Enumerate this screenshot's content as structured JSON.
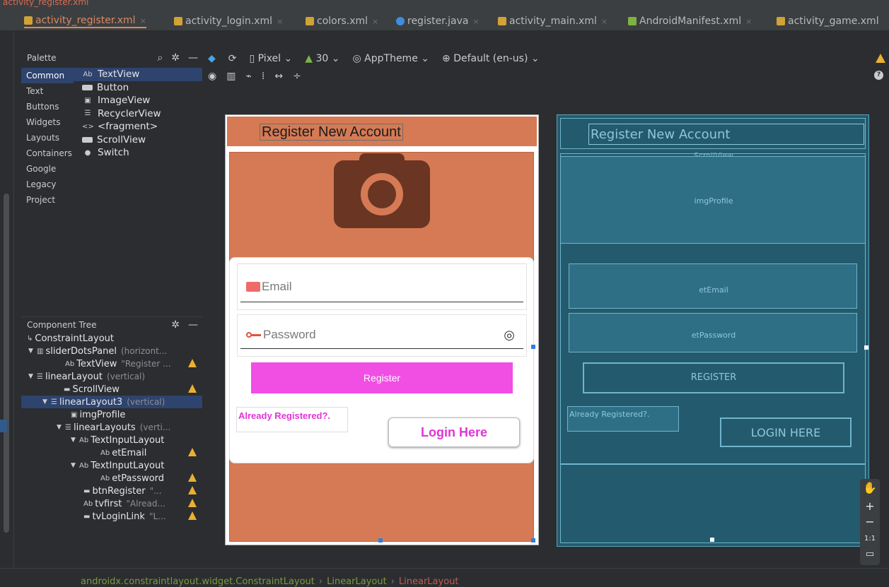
{
  "top_strip_file": "activity_register.xml",
  "tabs": [
    {
      "label": "activity_register.xml",
      "type": "xml",
      "active": true
    },
    {
      "label": "activity_login.xml",
      "type": "xml",
      "active": false
    },
    {
      "label": "colors.xml",
      "type": "xml",
      "active": false
    },
    {
      "label": "register.java",
      "type": "java",
      "active": false
    },
    {
      "label": "activity_main.xml",
      "type": "xml",
      "active": false
    },
    {
      "label": "AndroidManifest.xml",
      "type": "manifest",
      "active": false
    },
    {
      "label": "activity_game.xml",
      "type": "xml",
      "active": false
    }
  ],
  "palette": {
    "title": "Palette",
    "categories": [
      "Common",
      "Text",
      "Buttons",
      "Widgets",
      "Layouts",
      "Containers",
      "Google",
      "Legacy",
      "Project"
    ],
    "items": [
      {
        "icon": "Ab",
        "label": "TextView"
      },
      {
        "icon": "button-icon",
        "label": "Button"
      },
      {
        "icon": "image-icon",
        "label": "ImageView"
      },
      {
        "icon": "list-icon",
        "label": "RecyclerView"
      },
      {
        "icon": "<>",
        "label": "<fragment>"
      },
      {
        "icon": "scroll-icon",
        "label": "ScrollView"
      },
      {
        "icon": "switch-icon",
        "label": "Switch"
      }
    ]
  },
  "component_tree": {
    "title": "Component Tree",
    "nodes": [
      {
        "indent": 0,
        "label": "ConstraintLayout",
        "detail": "",
        "warn": false,
        "arrow": ""
      },
      {
        "indent": 0,
        "label": "sliderDotsPanel",
        "detail": "(horizont...",
        "warn": false,
        "arrow": "▼"
      },
      {
        "indent": 3,
        "label": "TextView",
        "detail": "\"Register ...",
        "warn": true,
        "arrow": ""
      },
      {
        "indent": 0,
        "label": "linearLayout",
        "detail": "(vertical)",
        "warn": false,
        "arrow": "▼"
      },
      {
        "indent": 2,
        "label": "ScrollView",
        "detail": "",
        "warn": true,
        "arrow": ""
      },
      {
        "indent": 1,
        "label": "linearLayout3",
        "detail": "(vertical)",
        "warn": false,
        "arrow": "▼",
        "selected": true
      },
      {
        "indent": 3,
        "label": "imgProfile",
        "detail": "",
        "warn": false,
        "arrow": ""
      },
      {
        "indent": 2,
        "label": "linearLayouts",
        "detail": "(verti...",
        "warn": false,
        "arrow": "▼"
      },
      {
        "indent": 3,
        "label": "TextInputLayout",
        "detail": "",
        "warn": false,
        "arrow": "▼"
      },
      {
        "indent": 5,
        "label": "etEmail",
        "detail": "",
        "warn": true,
        "arrow": ""
      },
      {
        "indent": 3,
        "label": "TextInputLayout",
        "detail": "",
        "warn": false,
        "arrow": "▼"
      },
      {
        "indent": 5,
        "label": "etPassword",
        "detail": "",
        "warn": true,
        "arrow": ""
      },
      {
        "indent": 3,
        "label": "btnRegister",
        "detail": "\"...",
        "warn": true,
        "arrow": ""
      },
      {
        "indent": 3,
        "label": "tvfirst",
        "detail": "\"Alread...",
        "warn": true,
        "arrow": ""
      },
      {
        "indent": 3,
        "label": "tvLoginLink",
        "detail": "\"L...",
        "warn": true,
        "arrow": ""
      }
    ]
  },
  "design_toolbar": {
    "device": "Pixel",
    "api": "30",
    "theme": "AppTheme",
    "locale": "Default (en-us)"
  },
  "design": {
    "appbar_title": "Register New Account",
    "email_hint": "Email",
    "password_hint": "Password",
    "register_label": "Register",
    "already_text": "Already Registered?.",
    "login_label": "Login Here"
  },
  "blueprint": {
    "title": "Register New Account",
    "scrollview": "ScrollView",
    "img": "imgProfile",
    "email": "etEmail",
    "password": "etPassword",
    "register": "REGISTER",
    "already": "Already Registered?.",
    "login": "LOGIN HERE"
  },
  "zoom": {
    "one_to_one": "1:1"
  },
  "breadcrumb": [
    "androidx.constraintlayout.widget.ConstraintLayout",
    "LinearLayout",
    "LinearLayout"
  ],
  "colors": {
    "appbar": "#d57a54",
    "register_btn": "#f14ee3",
    "accent_text": "#e035d6",
    "blueprint": "#245a6d"
  }
}
